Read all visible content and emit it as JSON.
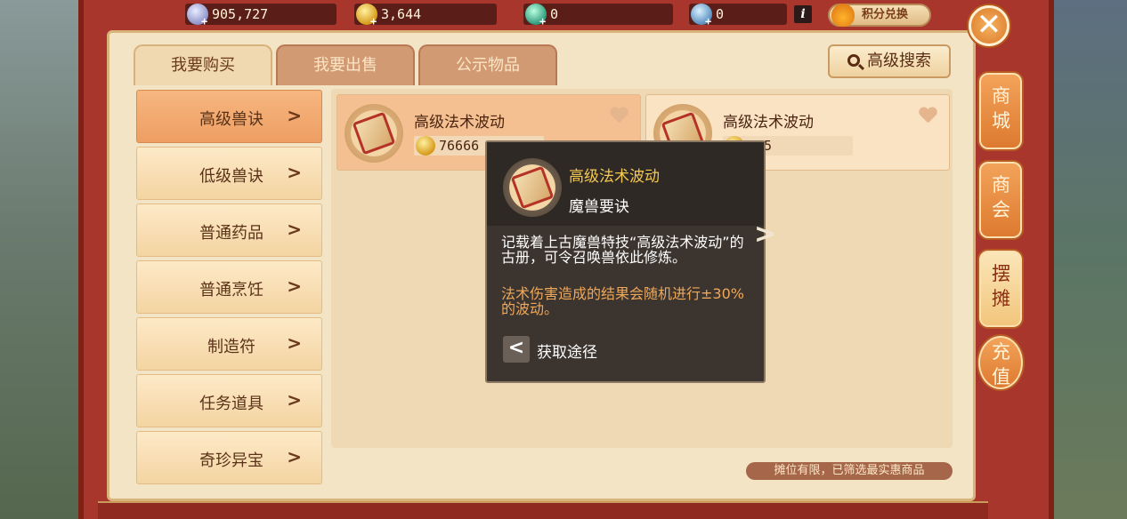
{
  "currencies": [
    {
      "name": "silver-coin-icon",
      "value": "905,727"
    },
    {
      "name": "gold-coin-icon",
      "value": "3,644"
    },
    {
      "name": "jade-icon",
      "value": "0"
    },
    {
      "name": "gem-icon",
      "value": "0"
    }
  ],
  "points_exchange_label": "积分兑换",
  "tabs": [
    {
      "label": "我要购买",
      "active": true
    },
    {
      "label": "我要出售",
      "active": false
    },
    {
      "label": "公示物品",
      "active": false
    }
  ],
  "advanced_search_label": "高级搜索",
  "categories": [
    {
      "label": "高级兽诀",
      "active": true
    },
    {
      "label": "低级兽诀",
      "active": false
    },
    {
      "label": "普通药品",
      "active": false
    },
    {
      "label": "普通烹饪",
      "active": false
    },
    {
      "label": "制造符",
      "active": false
    },
    {
      "label": "任务道具",
      "active": false
    },
    {
      "label": "奇珍异宝",
      "active": false
    }
  ],
  "items": [
    {
      "name": "高级法术波动",
      "price": "76666"
    },
    {
      "name": "高级法术波动",
      "price": "555"
    }
  ],
  "tooltip": {
    "name": "高级法术波动",
    "type": "魔兽要诀",
    "description": "记载着上古魔兽特技“高级法术波动”的古册，可令召唤兽依此修炼。",
    "effect": "法术伤害造成的结果会随机进行±30%的波动。",
    "source_label": "获取途径"
  },
  "notice": "摊位有限，已筛选最实惠商品",
  "side_buttons": [
    {
      "label": "商城"
    },
    {
      "label": "商会"
    },
    {
      "label": "摆摊"
    },
    {
      "label": "充值"
    }
  ]
}
